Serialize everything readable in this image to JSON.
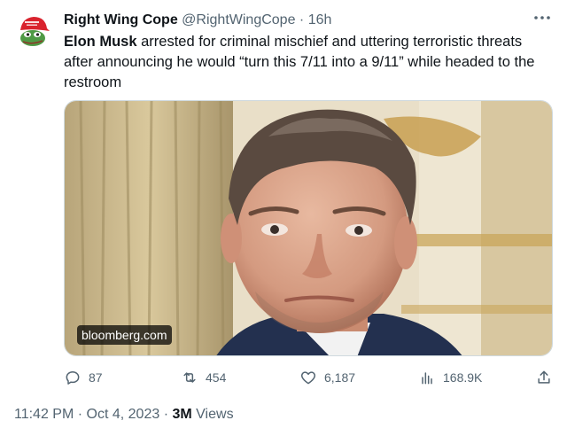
{
  "author": {
    "name": "Right Wing Cope",
    "handle": "@RightWingCope",
    "separator": "·",
    "time_ago": "16h"
  },
  "tweet": {
    "bold_name": "Elon Musk",
    "text": " arrested for criminal mischief and uttering terroristic threats after announcing he would “turn this 7/11 into a 9/11” while headed to the restroom"
  },
  "media": {
    "watermark": "bloomberg.com"
  },
  "actions": {
    "replies": "87",
    "retweets": "454",
    "likes": "6,187",
    "views": "168.9K"
  },
  "meta": {
    "time": "11:42 PM",
    "separator1": "·",
    "date": "Oct 4, 2023",
    "separator2": "·",
    "views_count": "3M",
    "views_label": "Views"
  },
  "icons": [
    "more-icon",
    "reply-icon",
    "retweet-icon",
    "like-icon",
    "views-icon",
    "share-icon"
  ],
  "colors": {
    "text": "#0f1419",
    "secondary": "#536471",
    "border": "#cfd9de",
    "avatar_hat": "#d9232e",
    "avatar_frog": "#4f9a45"
  }
}
